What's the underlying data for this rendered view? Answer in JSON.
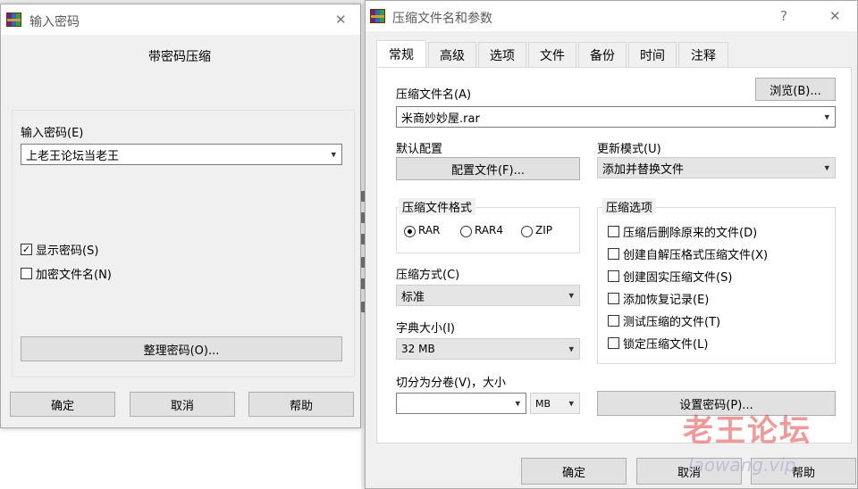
{
  "password_dialog": {
    "title": "输入密码",
    "heading": "带密码压缩",
    "password_label": "输入密码(E)",
    "password_value": "上老王论坛当老王",
    "show_password_label": "显示密码(S)",
    "show_password_checked": true,
    "encrypt_filenames_label": "加密文件名(N)",
    "encrypt_filenames_checked": false,
    "organize_button": "整理密码(O)...",
    "ok_button": "确定",
    "cancel_button": "取消",
    "help_button": "帮助",
    "close_glyph": "✕"
  },
  "archive_dialog": {
    "title": "压缩文件名和参数",
    "help_glyph": "?",
    "close_glyph": "✕",
    "tabs": [
      "常规",
      "高级",
      "选项",
      "文件",
      "备份",
      "时间",
      "注释"
    ],
    "active_tab": "常规",
    "archive_name_label": "压缩文件名(A)",
    "browse_button": "浏览(B)...",
    "archive_name_value": "米商妙妙屋.rar",
    "default_profile_label": "默认配置",
    "profile_button": "配置文件(F)...",
    "update_mode_label": "更新模式(U)",
    "update_mode_value": "添加并替换文件",
    "format_group_title": "压缩文件格式",
    "formats": [
      {
        "label": "RAR",
        "checked": true
      },
      {
        "label": "RAR4",
        "checked": false
      },
      {
        "label": "ZIP",
        "checked": false
      }
    ],
    "method_label": "压缩方式(C)",
    "method_value": "标准",
    "dict_label": "字典大小(I)",
    "dict_value": "32 MB",
    "split_label": "切分为分卷(V)，大小",
    "split_value": "",
    "split_unit": "MB",
    "options_group_title": "压缩选项",
    "options": [
      {
        "label": "压缩后删除原来的文件(D)",
        "checked": false
      },
      {
        "label": "创建自解压格式压缩文件(X)",
        "checked": false
      },
      {
        "label": "创建固实压缩文件(S)",
        "checked": false
      },
      {
        "label": "添加恢复记录(E)",
        "checked": false
      },
      {
        "label": "测试压缩的文件(T)",
        "checked": false
      },
      {
        "label": "锁定压缩文件(L)",
        "checked": false
      }
    ],
    "set_password_button": "设置密码(P)...",
    "ok_button": "确定",
    "cancel_button": "取消",
    "help_button": "帮助"
  },
  "watermark": {
    "cn": "老王论坛",
    "en": "laowang.vip"
  },
  "icons": {
    "dropdown": "▾",
    "check": "✓"
  }
}
